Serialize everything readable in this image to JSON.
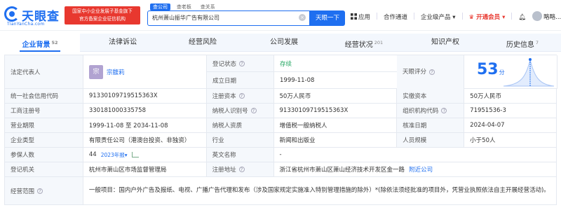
{
  "header": {
    "logo_name": "天眼查",
    "logo_url": "TianYanCha.com",
    "badge_line1": "国家中小企业发展子基金旗下",
    "badge_line2": "官方备案企业征信机构",
    "search_tabs": [
      "查公司",
      "查老板",
      "查关系"
    ],
    "search_value": "杭州萧山振华广告有限公司",
    "search_button": "天眼一下",
    "nav": {
      "app": "应用",
      "partner": "合作通道",
      "enterprise": "企业级产品",
      "vip": "开通会员",
      "user": "略略..."
    }
  },
  "tabs": [
    {
      "label": "企业背景",
      "count": "52"
    },
    {
      "label": "法律诉讼",
      "count": ""
    },
    {
      "label": "经营风险",
      "count": ""
    },
    {
      "label": "公司发展",
      "count": ""
    },
    {
      "label": "经营状况",
      "count": "201"
    },
    {
      "label": "知识产权",
      "count": ""
    },
    {
      "label": "历史信息",
      "count": "7"
    }
  ],
  "table": {
    "legal_rep_label": "法定代表人",
    "legal_rep_mark": "宗",
    "legal_rep_name": "宗馥莉",
    "status_label": "登记状态",
    "status_value": "存续",
    "founded_label": "成立日期",
    "founded_value": "1999-11-08",
    "score_label": "天眼评分",
    "score_value": "53",
    "score_unit": "分",
    "credit_code_label": "统一社会信用代码",
    "credit_code_value": "91330109719515363X",
    "reg_capital_label": "注册资本",
    "reg_capital_value": "50万人民币",
    "paid_capital_label": "实缴资本",
    "paid_capital_value": "50万人民币",
    "reg_no_label": "工商注册号",
    "reg_no_value": "330181000335758",
    "tax_id_label": "纳税人识别号",
    "tax_id_value": "91330109719515363X",
    "org_code_label": "组织机构代码",
    "org_code_value": "71951536-3",
    "term_label": "营业期限",
    "term_value": "1999-11-08 至 2034-11-08",
    "taxpayer_label": "纳税人资质",
    "taxpayer_value": "增值税一般纳税人",
    "approval_label": "核准日期",
    "approval_value": "2024-04-07",
    "type_label": "企业类型",
    "type_value": "有限责任公司（港澳台投资、非独资）",
    "industry_label": "行业",
    "industry_value": "新闻和出版业",
    "size_label": "人员规模",
    "size_value": "小于50人",
    "insured_label": "参保人数",
    "insured_value": "44",
    "insured_year": "2023年报",
    "eng_name_label": "英文名称",
    "eng_name_value": "-",
    "authority_label": "登记机关",
    "authority_value": "杭州市萧山区市场监督管理局",
    "address_label": "注册地址",
    "address_value": "浙江省杭州市萧山区萧山经济技术开发区金一路",
    "address_link": "附近公司",
    "scope_label": "经营范围",
    "scope_value": "一般项目：国内户外广告及报纸、电视、广播广告代理和发布（涉及国家规定实施准入特别管理措施的除外）*(除依法须经批准的项目外，凭营业执照依法自主开展经营活动)。"
  },
  "colors": {
    "brand": "#1f6ff0",
    "badge": "#e8382f",
    "status_green": "#22a660"
  }
}
